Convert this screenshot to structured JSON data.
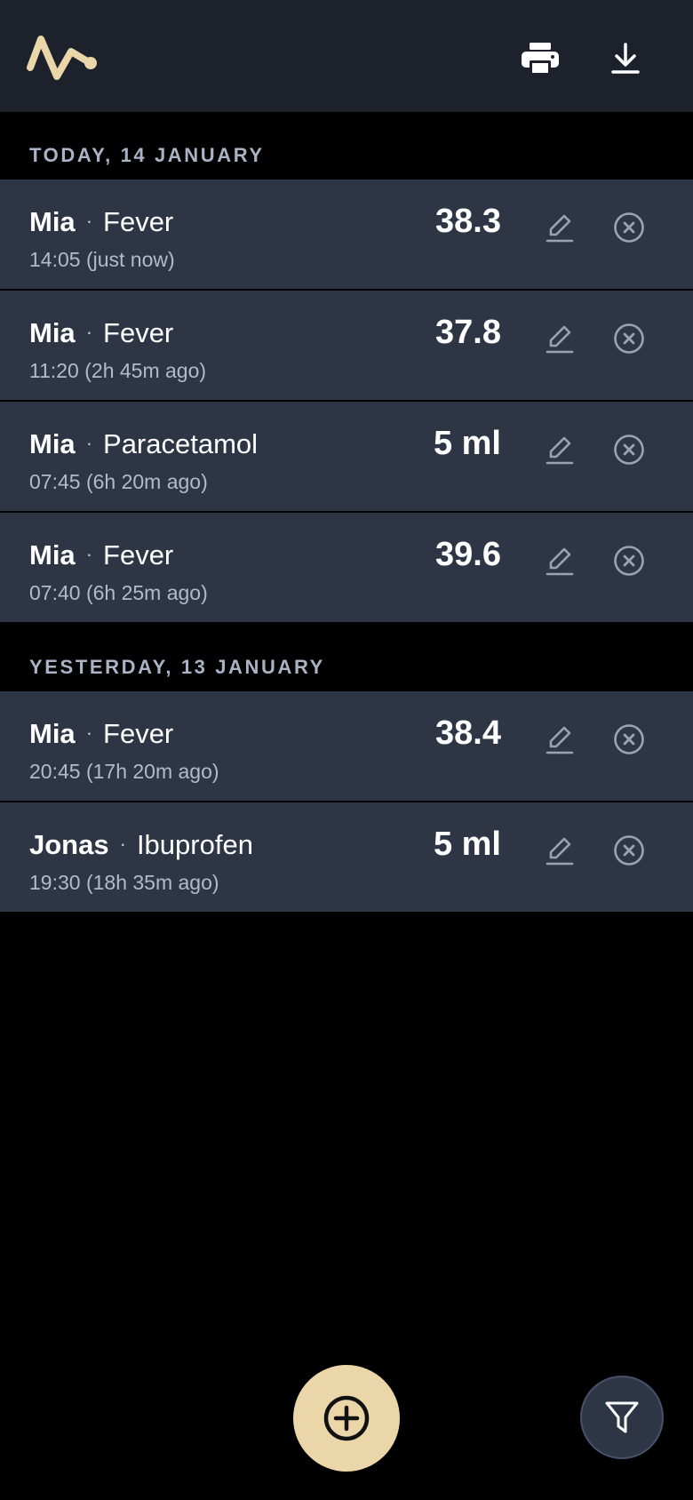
{
  "colors": {
    "accent": "#ebd6aa",
    "topbar_bg": "#1c212c",
    "card_bg": "#2e3646",
    "page_bg": "#000000",
    "section_header_text": "#aab3c5",
    "secondary_text": "#b3bac8",
    "icon_muted": "#9aa2b4"
  },
  "header": {
    "logo_icon": "pulse-line-logo",
    "actions": [
      {
        "icon": "printer-icon"
      },
      {
        "icon": "download-icon"
      }
    ]
  },
  "sections": [
    {
      "title": "TODAY, 14 JANUARY",
      "entries": [
        {
          "person": "Mia",
          "type": "Fever",
          "value": "38.3",
          "time": "14:05 (just now)"
        },
        {
          "person": "Mia",
          "type": "Fever",
          "value": "37.8",
          "time": "11:20 (2h 45m ago)"
        },
        {
          "person": "Mia",
          "type": "Paracetamol",
          "value": "5 ml",
          "time": "07:45 (6h 20m ago)"
        },
        {
          "person": "Mia",
          "type": "Fever",
          "value": "39.6",
          "time": "07:40 (6h 25m ago)"
        }
      ]
    },
    {
      "title": "YESTERDAY, 13 JANUARY",
      "entries": [
        {
          "person": "Mia",
          "type": "Fever",
          "value": "38.4",
          "time": "20:45 (17h 20m ago)"
        },
        {
          "person": "Jonas",
          "type": "Ibuprofen",
          "value": "5 ml",
          "time": "19:30 (18h 35m ago)"
        }
      ]
    }
  ],
  "entry_separator": "·",
  "entry_actions": {
    "edit_icon": "pencil-icon",
    "delete_icon": "close-circle-icon"
  },
  "fab": {
    "add_icon": "plus-circle-icon",
    "filter_icon": "filter-icon"
  }
}
